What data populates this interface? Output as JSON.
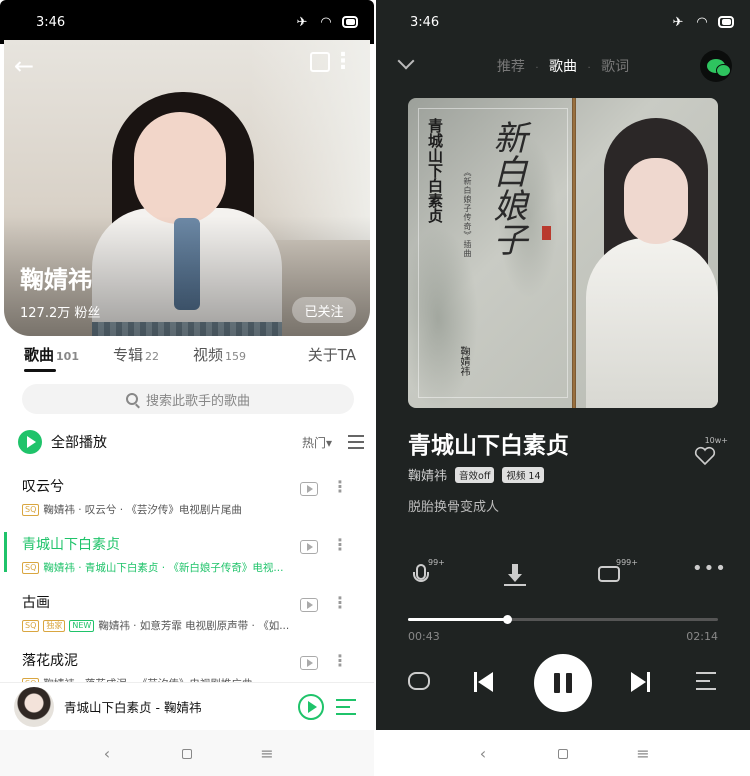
{
  "left": {
    "status": {
      "time": "3:46"
    },
    "artist": {
      "name": "鞠婧祎",
      "fans": "127.2万 粉丝",
      "follow_label": "已关注"
    },
    "tabs": [
      {
        "label": "歌曲",
        "count": "101"
      },
      {
        "label": "专辑",
        "count": "22"
      },
      {
        "label": "视频",
        "count": "159"
      },
      {
        "label": "关于TA",
        "count": ""
      }
    ],
    "search": {
      "placeholder": "搜索此歌手的歌曲"
    },
    "play_all": {
      "label": "全部播放",
      "sort": "热门▾"
    },
    "songs": [
      {
        "title": "叹云兮",
        "tags": [
          "SQ"
        ],
        "meta": "鞠婧祎 · 叹云兮 · 《芸汐传》电视剧片尾曲"
      },
      {
        "title": "青城山下白素贞",
        "tags": [
          "SQ"
        ],
        "meta": "鞠婧祎 · 青城山下白素贞 · 《新白娘子传奇》电视..."
      },
      {
        "title": "古画",
        "tags": [
          "SQ",
          "独家",
          "NEW"
        ],
        "meta": "鞠婧祎 · 如意芳霏 电视剧原声带 · 《如..."
      },
      {
        "title": "落花成泥",
        "tags": [
          "SQ"
        ],
        "meta": "鞠婧祎 · 落花成泥 · 《芸汐传》电视剧推广曲"
      }
    ],
    "mini_player": {
      "text": "青城山下白素贞 - 鞠婧祎"
    }
  },
  "right": {
    "status": {
      "time": "3:46"
    },
    "tabs": {
      "recommend": "推荐",
      "song": "歌曲",
      "lyrics": "歌词",
      "sep": "·"
    },
    "artwork": {
      "vertical_title": "青城山下白素贞",
      "subtitle": "《新白娘子传奇》插曲",
      "singer": "鞠婧祎",
      "calligraphy": "新白娘子"
    },
    "song": {
      "title": "青城山下白素贞",
      "artist": "鞠婧祎",
      "quality_badge": "音效off",
      "video_badge": "视频 14",
      "lyric_line": "脱胎换骨变成人",
      "like_count": "10w+"
    },
    "actions": {
      "mic_count": "99+",
      "comment_count": "999+",
      "more": "•••"
    },
    "progress": {
      "current": "00:43",
      "total": "02:14",
      "fraction": 0.32
    }
  },
  "sysnav": {
    "back": "‹",
    "recent": "≡"
  },
  "colors": {
    "accent_green": "#1fc36a",
    "player_bg": "#1f2322"
  }
}
